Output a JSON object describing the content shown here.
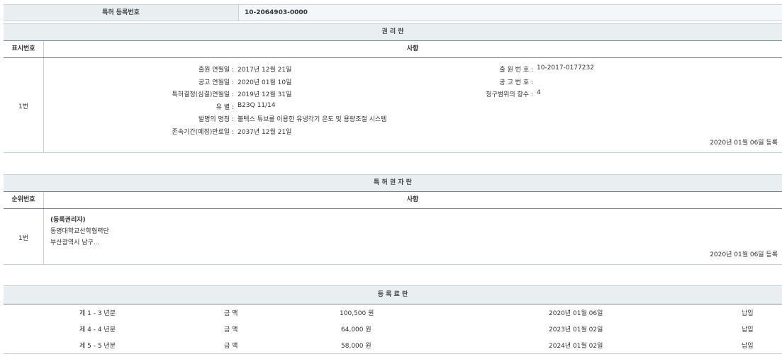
{
  "top_header": {
    "label": "특허 등록번호",
    "value": "10-2064903-0000"
  },
  "rights_section": {
    "title": "권 리 란",
    "col_num": "표시번호",
    "col_content": "사항",
    "row_num": "1번",
    "left_fields": [
      {
        "label": "출원 연월일",
        "value": "2017년 12월 21일"
      },
      {
        "label": "공고 연월일",
        "value": "2020년 01월 10일"
      },
      {
        "label": "특허결정(심결)연월일",
        "value": "2019년 12월 31일"
      },
      {
        "label": "유 별",
        "value": "B23Q 11/14"
      },
      {
        "label": "발명의 명칭",
        "value": "볼텍스 튜브를 이용한 유냉각기 온도 및 용량조절 시스템"
      },
      {
        "label": "존속기간(예정)만료일",
        "value": "2037년 12월 21일"
      }
    ],
    "right_fields": [
      {
        "label": "출 원 번 호",
        "value": "10-2017-0177232"
      },
      {
        "label": "공 고 번 호",
        "value": ""
      },
      {
        "label": "청구범위의 항수",
        "value": "4"
      }
    ],
    "reg_date": "2020년 01월 06일 등록"
  },
  "holder_section": {
    "title": "특 허 권 자 란",
    "col_num": "순위번호",
    "col_content": "사항",
    "row_num": "1번",
    "lines": [
      "(등록권리자)",
      "동명대학교산학협력단",
      "부산광역시 남구..."
    ],
    "reg_date": "2020년 01월 06일 등록"
  },
  "fee_section": {
    "title": "등 록 료 란",
    "rows": [
      {
        "period": "제 1 - 3 년분",
        "label": "금 액",
        "amount": "100,500 원",
        "date": "2020년 01월 06일",
        "status": "납입"
      },
      {
        "period": "제 4 - 4 년분",
        "label": "금 액",
        "amount": "64,000 원",
        "date": "2023년 01월 02일",
        "status": "납입"
      },
      {
        "period": "제 5 - 5 년분",
        "label": "금 액",
        "amount": "58,000 원",
        "date": "2024년 01월 02일",
        "status": "납입"
      }
    ]
  }
}
